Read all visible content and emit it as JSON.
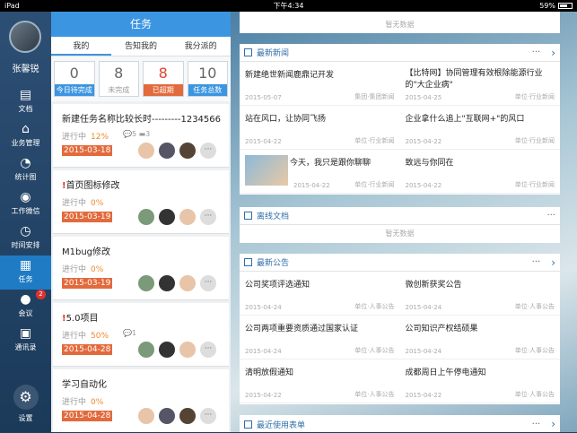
{
  "status": {
    "device": "iPad",
    "time": "下午4:34",
    "battery": "59%"
  },
  "user": {
    "name": "张馨锐"
  },
  "nav": [
    {
      "label": "文档",
      "icon": "document-icon"
    },
    {
      "label": "业务管理",
      "icon": "home-icon"
    },
    {
      "label": "统计图",
      "icon": "chart-icon"
    },
    {
      "label": "工作微信",
      "icon": "chat-icon"
    },
    {
      "label": "时间安排",
      "icon": "clock-icon"
    },
    {
      "label": "任务",
      "icon": "calendar-icon"
    },
    {
      "label": "会议",
      "icon": "meeting-icon",
      "badge": "2"
    },
    {
      "label": "通讯录",
      "icon": "contacts-icon"
    },
    {
      "label": "设置",
      "icon": "gear-icon"
    }
  ],
  "tasks": {
    "title": "任务",
    "tabs": [
      "我的",
      "告知我的",
      "我分派的"
    ],
    "stats": [
      {
        "num": "0",
        "label": "今日待完成"
      },
      {
        "num": "8",
        "label": "未完成"
      },
      {
        "num": "8",
        "label": "已超期"
      },
      {
        "num": "10",
        "label": "任务总数"
      }
    ],
    "progress_label": "进行中",
    "items": [
      {
        "title": "新建任务名称比较长时---------1234566",
        "urgent": "",
        "pct": "12%",
        "comments": "5",
        "files": "3",
        "date": "2015-03-18"
      },
      {
        "title": "首页图标修改",
        "urgent": "!",
        "pct": "0%",
        "comments": "",
        "files": "",
        "date": "2015-03-19"
      },
      {
        "title": "M1bug修改",
        "urgent": "",
        "pct": "0%",
        "comments": "",
        "files": "",
        "date": "2015-03-19"
      },
      {
        "title": "5.0项目",
        "urgent": "!",
        "pct": "50%",
        "comments": "1",
        "files": "",
        "date": "2015-04-28"
      },
      {
        "title": "学习自动化",
        "urgent": "",
        "pct": "0%",
        "comments": "",
        "files": "",
        "date": "2015-04-28"
      }
    ],
    "more": "···"
  },
  "top_empty": "暂无数据",
  "news": {
    "title": "最新新闻",
    "items": [
      {
        "title": "新建绝世新闻鹿鼎记开发",
        "date": "2015-05-07",
        "source": "集团·集团新闻"
      },
      {
        "title": "【比特网】协同管理有效根除能源行业的\"大企业病\"",
        "date": "2015-04-25",
        "source": "单位·行业新闻"
      },
      {
        "title": "站在风口，让协同飞扬",
        "date": "2015-04-22",
        "source": "单位·行业新闻"
      },
      {
        "title": "企业拿什么追上\"互联网+\"的风口",
        "date": "2015-04-22",
        "source": "单位·行业新闻"
      },
      {
        "title": "今天，我只是跟你聊聊",
        "date": "2015-04-22",
        "source": "单位·行业新闻"
      },
      {
        "title": "致远与你同在",
        "date": "2015-04-22",
        "source": "单位·行业新闻"
      }
    ]
  },
  "offline": {
    "title": "离线文档",
    "empty": "暂无数据"
  },
  "notice": {
    "title": "最新公告",
    "items": [
      {
        "title": "公司奖项评选通知",
        "date": "2015-04-24",
        "source": "单位·人事公告"
      },
      {
        "title": "微创新获奖公告",
        "date": "2015-04-24",
        "source": "单位·人事公告"
      },
      {
        "title": "公司两项重要资质通过国家认证",
        "date": "2015-04-24",
        "source": "单位·人事公告"
      },
      {
        "title": "公司知识产权结硕果",
        "date": "2015-04-24",
        "source": "单位·人事公告"
      },
      {
        "title": "清明放假通知",
        "date": "2015-04-22",
        "source": "单位·人事公告"
      },
      {
        "title": "成都周日上午停电通知",
        "date": "2015-04-22",
        "source": "单位·人事公告"
      }
    ]
  },
  "forms": {
    "title": "最近使用表单"
  },
  "more": "···"
}
